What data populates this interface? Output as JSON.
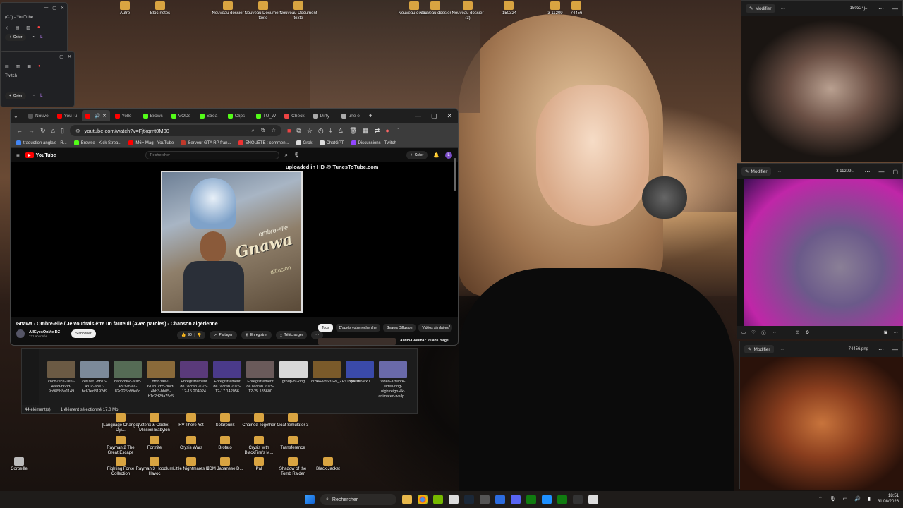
{
  "desktop": {
    "top_icons": [
      "Autre",
      "Bloc-notes",
      "Nouveau dossier",
      "Nouveau Document texte",
      "Nouveau Document texte",
      "Nouveau dossier",
      "Nouveau dossier",
      "Nouveau dossier (3)",
      "-150324",
      "3 11209",
      "74456"
    ],
    "bottom_icons": [
      [
        "[Language Change] Dyi...",
        "Asterix & Obelix - Mission Babylon",
        "RV There Yet",
        "Solarpunk",
        "Chained Together",
        "Goat Simulator 3"
      ],
      [
        "Rayman 2 The Great Escape",
        "Fortnite",
        "Crysis Wars",
        "Brotato",
        "Crysis with BlackFire's M...",
        "Transference"
      ],
      [
        "Fighting Force Collection",
        "Rayman 3 Hoodlum Havoc",
        "Little Nightmares III",
        "JDM Japanese D...",
        "Pal",
        "Shadow of the Tomb Raider",
        "Black Jacket"
      ]
    ],
    "corbeille": "Corbeille"
  },
  "mini_windows": {
    "w1_tab": "(CJ) - YouTube",
    "w1_create": "Créer",
    "w2_tab": "Twitch",
    "w2_create": "Créer"
  },
  "browser": {
    "tabs": [
      "Nouve",
      "YouTu",
      "",
      "Yelle",
      "Brows",
      "VODs",
      "Strea",
      "Clips",
      "TU_W",
      "Check",
      "Dirty",
      "une el"
    ],
    "url": "youtube.com/watch?v=Fjtkqmt0M00",
    "bookmarks": [
      "traduction anglais - R...",
      "Browse - Kick Strea...",
      "M6+ Mag - YouTube",
      "Serveur GTA RP fran...",
      "ENQUÊTE : commen...",
      "Grok",
      "ChatGPT",
      "Discussions - Twitch"
    ],
    "youtube": {
      "logo": "YouTube",
      "search_placeholder": "Rechercher",
      "create": "Créer",
      "uploaded_text": "uploaded in HD @ TunesToTube.com",
      "cover_sub": "ombre-elle",
      "cover_title": "Gnawa",
      "cover_prod": "diffusion",
      "video_title": "Gnawa - Ombre-elle / Je voudrais être un fauteuil (Avec paroles) - Chanson algérienne",
      "channel_name": "AllEyesOnMe DZ",
      "channel_subs": "221 abonnés",
      "subscribe": "S'abonner",
      "likes": "90",
      "share": "Partager",
      "save": "Enregistrer",
      "download": "Télécharger",
      "chips": [
        "Tous",
        "D'après votre recherche",
        "Gnawa Diffusion",
        "Vidéos similaires"
      ],
      "next_rec": "Audio-Globina : 20 ans d'âge"
    }
  },
  "explorer": {
    "files": [
      "c8cd2ece-0e5f-4aa9-b63d-9b985b8e1149",
      "cef0fef1-db76-431c-a8e7-bc61ed8192d9",
      "dab5896c-afac-43f3-b9ea-82c225b99e6d",
      "dmb3ae2-61e81cb5-d8cf-4bb3-bb05-b1d2d29a75c5",
      "Enregistrement de l'écran 2025-12-15 204924",
      "Enregistrement de l'écran 2025-12-17 142056",
      "Enregistrement de l'écran 2025-12-25 185600",
      "group-of-king",
      "olzIAEvdS3SW_ZRz15MCw",
      "questuvexu",
      "video-artwork-elden-ring-nightreign-4k-animated-wallp..."
    ],
    "status_count": "44 élément(s)",
    "status_selected": "1 élément sélectionné  17,0 Mo"
  },
  "right_windows": {
    "modify": "Modifier",
    "file1": "-150324j...",
    "file2": "3 11209...",
    "file3": "74456.png"
  },
  "taskbar": {
    "search": "Rechercher",
    "time": "18:51",
    "date": "31/08/2026"
  }
}
